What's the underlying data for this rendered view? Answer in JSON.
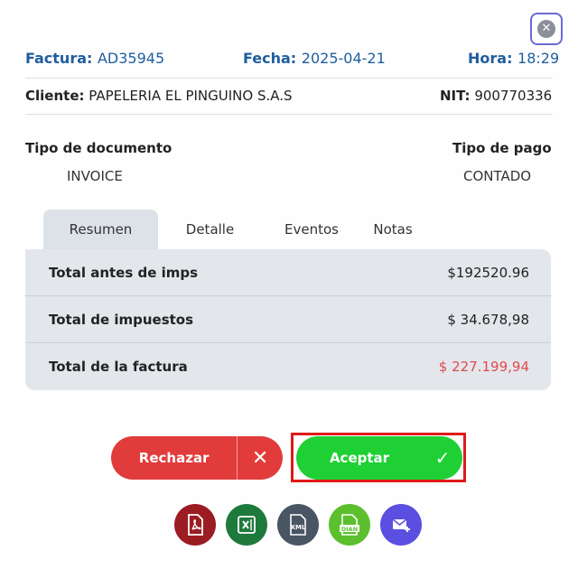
{
  "header": {
    "factura_label": "Factura:",
    "factura_value": "AD35945",
    "fecha_label": "Fecha:",
    "fecha_value": "2025-04-21",
    "hora_label": "Hora:",
    "hora_value": "18:29"
  },
  "client": {
    "cliente_label": "Cliente:",
    "cliente_value": "PAPELERIA EL PINGUINO S.A.S",
    "nit_label": "NIT:",
    "nit_value": "900770336"
  },
  "meta": {
    "doc_type_label": "Tipo de documento",
    "doc_type_value": "INVOICE",
    "payment_type_label": "Tipo de pago",
    "payment_type_value": "CONTADO"
  },
  "tabs": [
    {
      "label": "Resumen",
      "active": true
    },
    {
      "label": "Detalle",
      "active": false
    },
    {
      "label": "Eventos",
      "active": false
    },
    {
      "label": "Notas",
      "active": false
    }
  ],
  "summary": {
    "rows": [
      {
        "label": "Total antes de imps",
        "value": "$192520.96"
      },
      {
        "label": "Total de impuestos",
        "value": "$ 34.678,98"
      },
      {
        "label": "Total de la factura",
        "value": "$ 227.199,94"
      }
    ]
  },
  "actions": {
    "reject_label": "Rechazar",
    "reject_icon": "x-icon",
    "accept_label": "Aceptar",
    "accept_icon": "check-icon"
  },
  "file_icons": [
    {
      "name": "pdf-icon",
      "color": "#9b1c22"
    },
    {
      "name": "excel-icon",
      "color": "#1e7a3c"
    },
    {
      "name": "xml-icon",
      "color": "#4a5563"
    },
    {
      "name": "dian-icon",
      "color": "#5bbf2e"
    },
    {
      "name": "email-icon",
      "color": "#5a4fe0"
    }
  ],
  "colors": {
    "header_blue": "#1f5e9e",
    "reject_red": "#e23b3b",
    "accept_green": "#1fd034",
    "total_red": "#e04a4a",
    "highlight_red": "#e01a1a"
  }
}
